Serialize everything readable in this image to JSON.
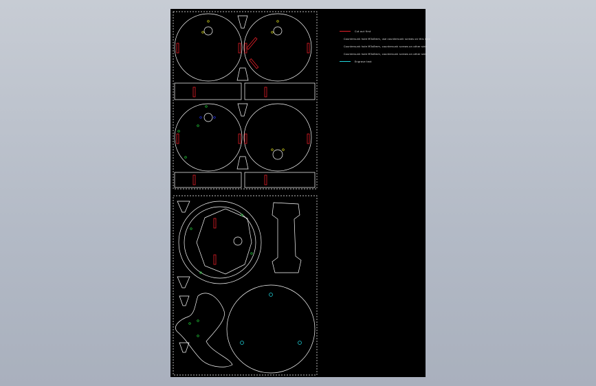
{
  "colors": {
    "viewport_top": "#c7ccd4",
    "viewport_bottom": "#a9b0bd",
    "sheet": "#000000",
    "outline": "#ffffff",
    "cut_red": "#e8202a",
    "mark_yellow": "#e0e020",
    "mark_green": "#22d03a",
    "mark_blue": "#2030e8",
    "mark_cyan": "#20d8e0"
  },
  "legend": {
    "items": [
      {
        "label": "Cut out first",
        "color": "#e8202a"
      },
      {
        "label": "Countersunk hole M3x8mm, use countersunk screws on this side",
        "color": "#e0e020"
      },
      {
        "label": "Countersunk hole M3x8mm, countersunk screws on other side",
        "color": "#22d03a"
      },
      {
        "label": "Countersunk hole M3x8mm, countersunk screws on other side",
        "color": "#2030e8"
      },
      {
        "label": "Engrave text",
        "color": "#20d8e0"
      }
    ]
  }
}
